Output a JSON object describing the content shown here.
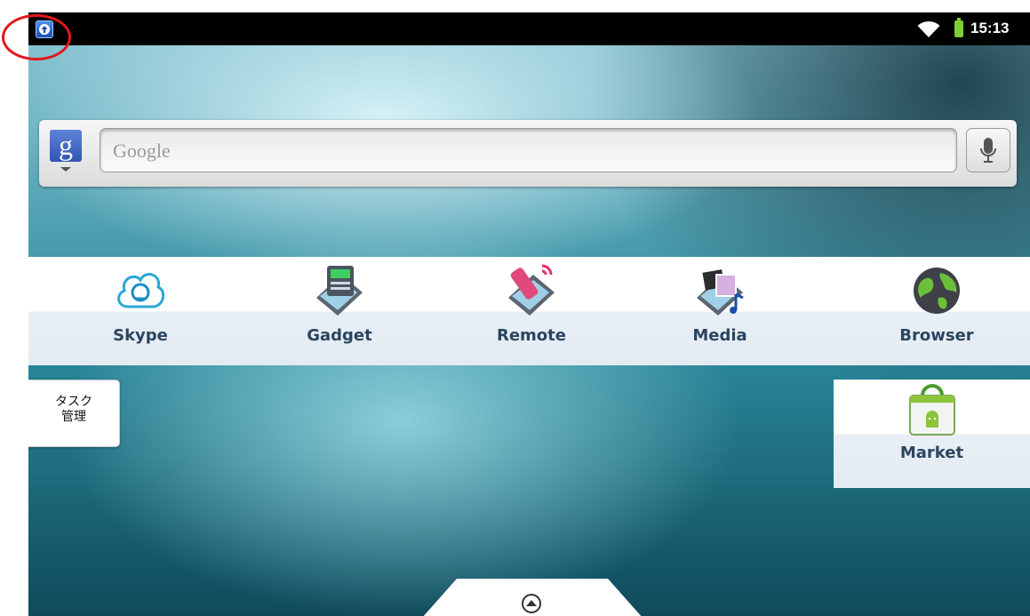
{
  "status_bar": {
    "clock": "15:13",
    "notification_icon": "upload-notification-icon",
    "wifi_icon": "wifi-icon",
    "battery_icon": "battery-icon"
  },
  "search_widget": {
    "placeholder": "Google",
    "google_button_icon": "google-g-icon",
    "mic_icon": "microphone-icon"
  },
  "apps": [
    {
      "label": "Skype",
      "icon": "skype-icon"
    },
    {
      "label": "Gadget",
      "icon": "gadget-icon"
    },
    {
      "label": "Remote",
      "icon": "remote-icon"
    },
    {
      "label": "Media",
      "icon": "media-icon"
    },
    {
      "label": "Browser",
      "icon": "browser-globe-icon"
    }
  ],
  "task_widget": {
    "label": "タスク\n管理"
  },
  "market": {
    "label": "Market",
    "icon": "market-bag-icon"
  },
  "drawer": {
    "icon": "app-drawer-arrow-icon"
  },
  "colors": {
    "annotation": "#e2181b",
    "status_bar": "#000000",
    "label": "#2a4560"
  }
}
